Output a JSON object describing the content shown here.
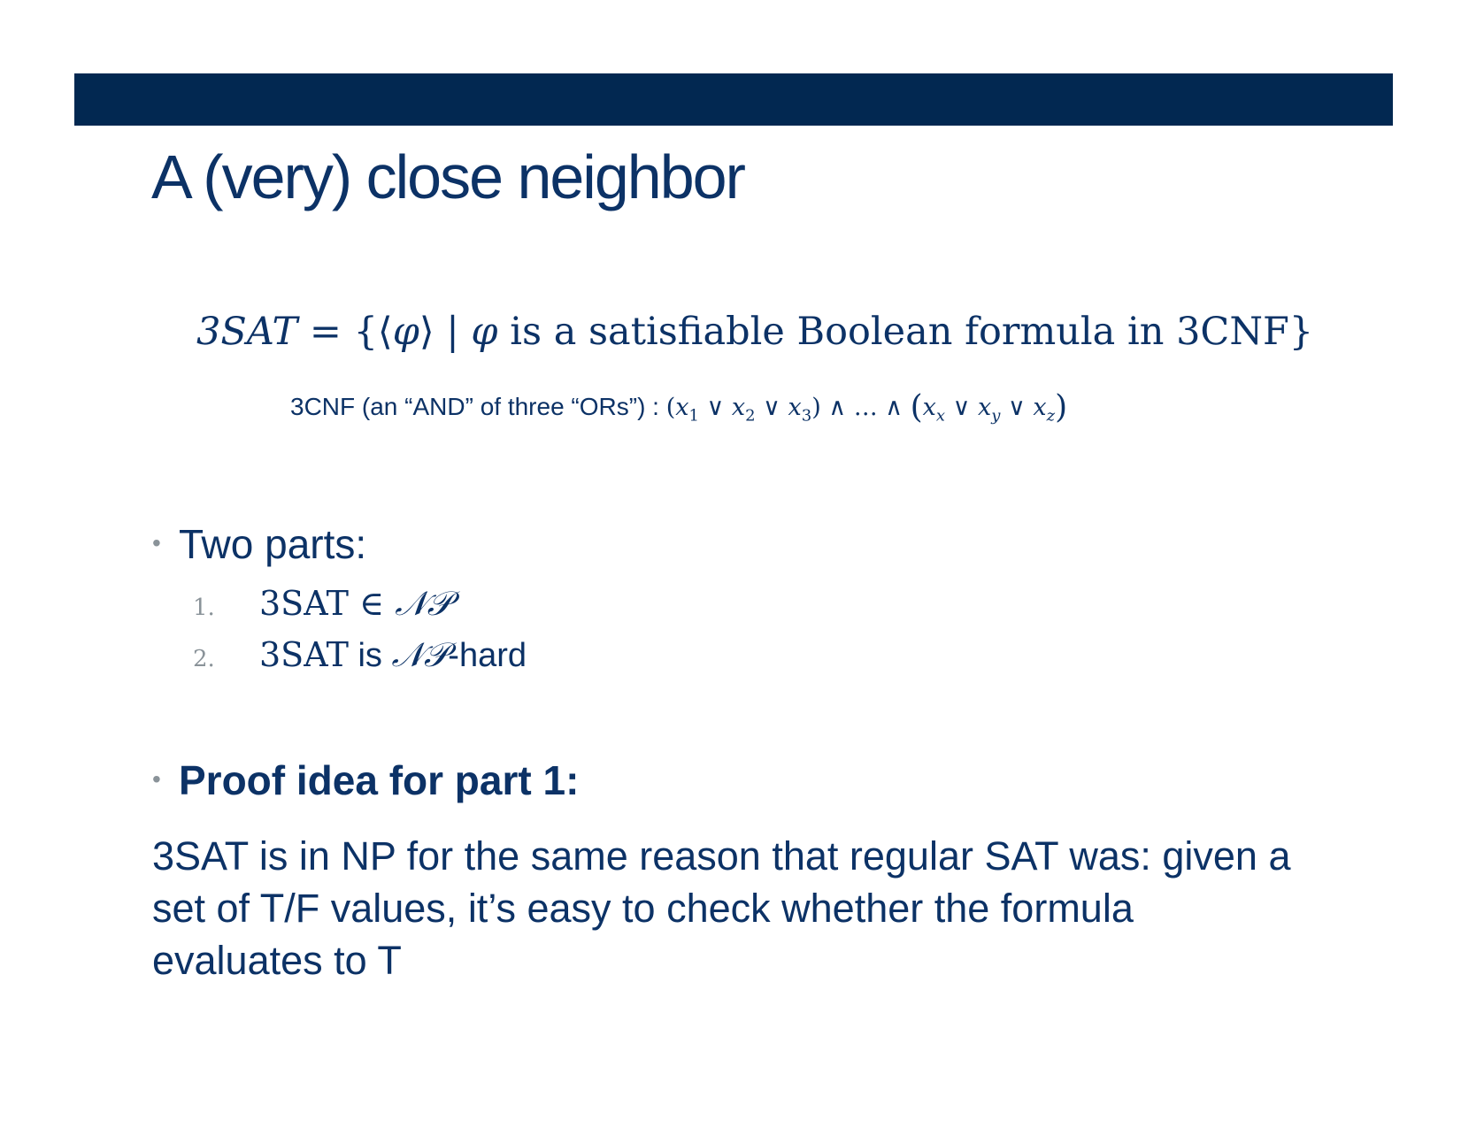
{
  "slide": {
    "title": "A (very) close neighbor",
    "definition": {
      "lhs": "3SAT",
      "equals": " = {⟨",
      "phi1": "φ",
      "mid": "⟩ | ",
      "phi2": "φ",
      "rest": " is a satisfiable Boolean formula in 3CNF}"
    },
    "cnf": {
      "label": "3CNF (an “AND” of three “ORs”) : ",
      "clause1_open": "(",
      "x": "x",
      "s1": "1",
      "s2": "2",
      "s3": "3",
      "or": " ∨ ",
      "clause1_close": ")",
      "and_dots": " ∧ … ∧ ",
      "clause2_open": "(",
      "sx": "x",
      "sy": "y",
      "sz": "z",
      "clause2_close": ")"
    },
    "bullet1": "Two parts:",
    "list": [
      {
        "num": "1.",
        "pre": "3SAT ∈ ",
        "np": "𝒩𝒫",
        "post": ""
      },
      {
        "num": "2.",
        "pre": "3SAT",
        "mid": " is ",
        "np": "𝒩𝒫",
        "post": "-hard"
      }
    ],
    "bullet2": "Proof idea for part 1:",
    "paragraph": "3SAT is in NP for the same reason that regular SAT was: given a set of T/F values, it’s easy to check whether the formula evaluates to T",
    "colors": {
      "bar": "#022851",
      "text": "#0c3266",
      "bullet": "#8a9399"
    }
  }
}
